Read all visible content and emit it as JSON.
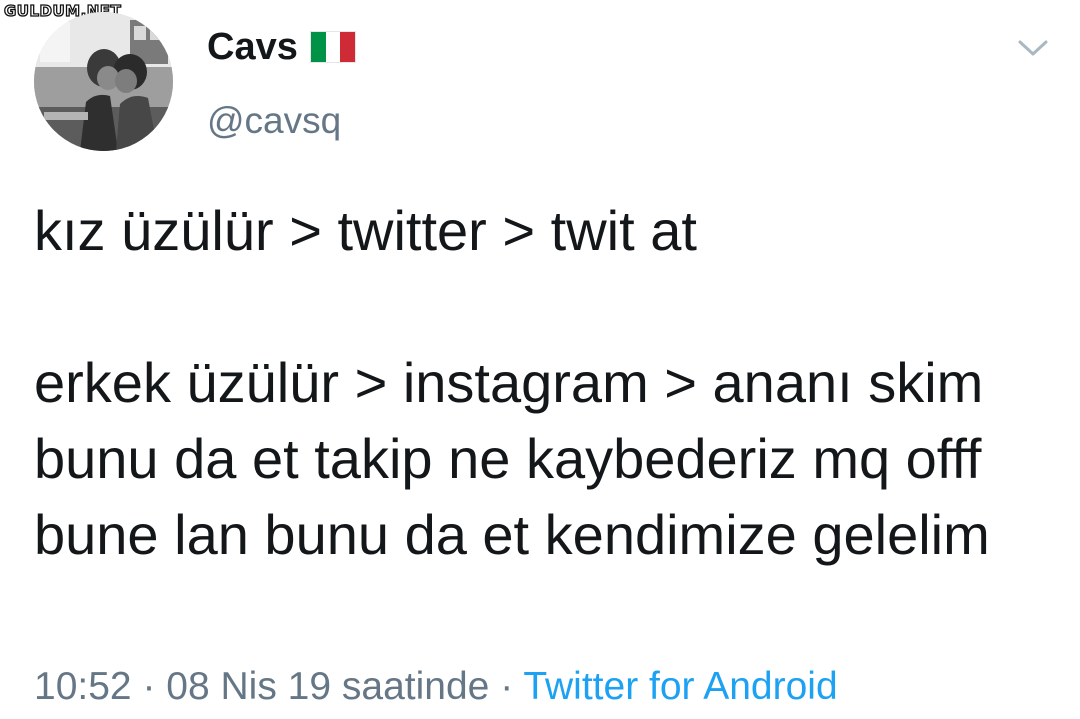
{
  "watermark": "GULDUM.NET",
  "tweet": {
    "display_name": "Cavs",
    "handle": "@cavsq",
    "text": "kız üzülür > twitter > twit at\n\nerkek üzülür > instagram > ananı skim bunu da et takip ne kaybederiz mq offf bune lan bunu da et kendimize gelelim",
    "time": "10:52",
    "separator": "·",
    "date": "08 Nis 19 saatinde",
    "source": "Twitter for Android"
  },
  "icons": {
    "flag": "italy-flag-icon",
    "menu": "chevron-down-icon"
  },
  "colors": {
    "text": "#14171a",
    "secondary": "#657786",
    "link": "#1da1f2",
    "flag": [
      "#009246",
      "#ffffff",
      "#ce2b37"
    ]
  }
}
